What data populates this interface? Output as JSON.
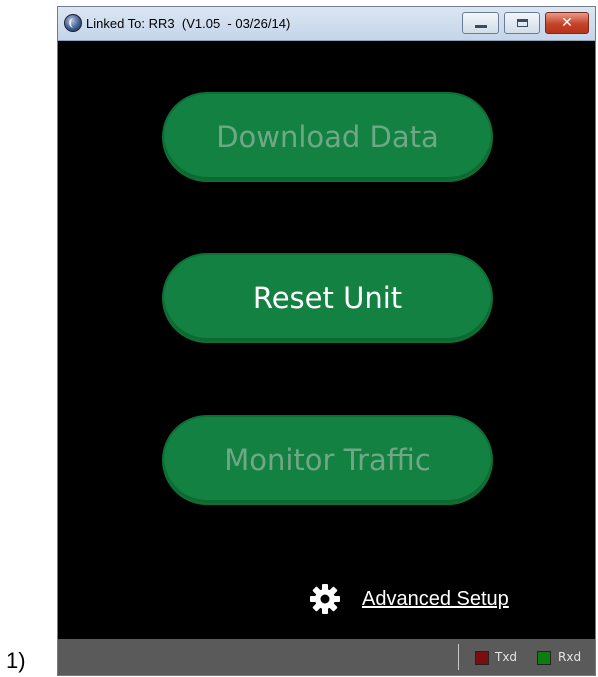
{
  "figure_label": "1)",
  "window": {
    "title": "Linked To: RR3  (V1.05  - 03/26/14)",
    "icon": "app-globe-icon"
  },
  "buttons": {
    "download_data": "Download Data",
    "reset_unit": "Reset Unit",
    "monitor_traffic": "Monitor Traffic"
  },
  "advanced_setup": {
    "label": "Advanced Setup",
    "icon": "gear-icon"
  },
  "status": {
    "txd_label": "Txd",
    "rxd_label": "Rxd",
    "txd_color": "#7a0e0e",
    "rxd_color": "#0e7a12"
  },
  "colors": {
    "background": "#000000",
    "button_green": "#138141",
    "disabled_text": "#6fa885",
    "enabled_text": "#ffffff"
  }
}
